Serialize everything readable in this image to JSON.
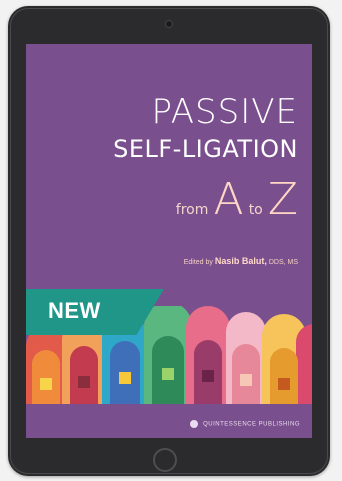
{
  "book": {
    "title_line1": "PASSIVE",
    "title_line2": "SELF-LIGATION",
    "title_from": "from",
    "title_a": "A",
    "title_to": "to",
    "title_z": "Z",
    "editor_prefix": "Edited by",
    "editor_name": "Nasib Balut,",
    "editor_suffix": "DDS, MS",
    "publisher": "QUINTESSENCE PUBLISHING"
  },
  "badge": {
    "label": "NEW"
  },
  "colors": {
    "cover_purple": "#7a4f8e",
    "ribbon_teal": "#1f9688",
    "device_frame": "#2b2b2d"
  },
  "icons": {
    "camera": "camera-dot-icon",
    "home": "home-button-icon",
    "publisher_logo": "quintessence-logo-icon"
  }
}
